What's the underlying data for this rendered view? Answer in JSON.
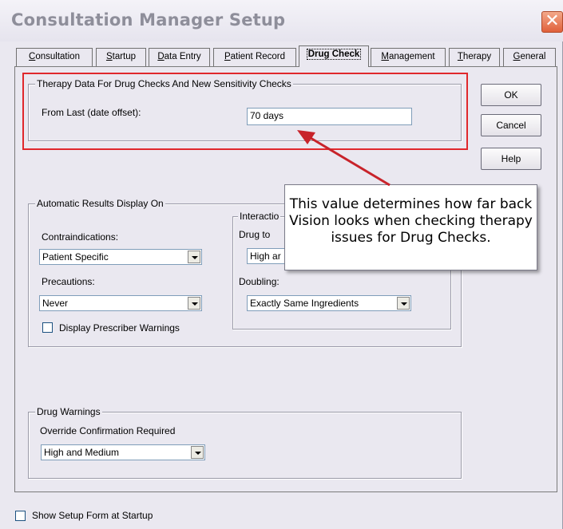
{
  "window": {
    "title": "Consultation Manager Setup",
    "close_glyph": "✕"
  },
  "tabs": [
    {
      "label": "Consultation",
      "underline": "C",
      "rest": "onsultation"
    },
    {
      "label": "Startup",
      "underline": "S",
      "rest": "tartup"
    },
    {
      "label": "Data Entry",
      "underline": "D",
      "rest": "ata Entry"
    },
    {
      "label": "Patient Record",
      "underline": "P",
      "rest": "atient Record"
    },
    {
      "label": "Drug Check",
      "active": true
    },
    {
      "label": "Management",
      "underline": "M",
      "rest": "anagement"
    },
    {
      "label": "Therapy",
      "underline": "T",
      "rest": "herapy"
    },
    {
      "label": "General",
      "underline": "G",
      "rest": "eneral"
    }
  ],
  "therapy_group": {
    "legend": "Therapy Data For Drug Checks And New Sensitivity Checks",
    "from_last_label": "From Last (date offset):",
    "from_last_value": "70 days"
  },
  "buttons": {
    "ok": "OK",
    "cancel": "Cancel",
    "help": "Help"
  },
  "results_group": {
    "legend": "Automatic Results Display On",
    "contraindications_label": "Contraindications:",
    "contraindications_value": "Patient Specific",
    "precautions_label": "Precautions:",
    "precautions_value": "Never",
    "prescriber_warnings_label": "Display Prescriber Warnings",
    "prescriber_warnings_checked": false
  },
  "interaction_group": {
    "legend": "Interactio",
    "drug_to_label": "Drug to",
    "drug_to_value": "High ar",
    "doubling_label": "Doubling:",
    "doubling_value": "Exactly Same Ingredients"
  },
  "drug_warnings_group": {
    "legend": "Drug Warnings",
    "override_label": "Override Confirmation Required",
    "override_value": "High and Medium"
  },
  "show_setup": {
    "label": "Show Setup Form at Startup",
    "checked": false
  },
  "callout": {
    "line1": "This value determines how far back",
    "line2": "Vision looks when checking therapy",
    "line3": "issues for Drug Checks."
  },
  "colors": {
    "highlight": "#e0282c",
    "window_bg": "#eae8f0",
    "title_text": "#8e8e9a"
  },
  "icons": {
    "close": "close-icon",
    "dropdown": "chevron-down-icon"
  }
}
